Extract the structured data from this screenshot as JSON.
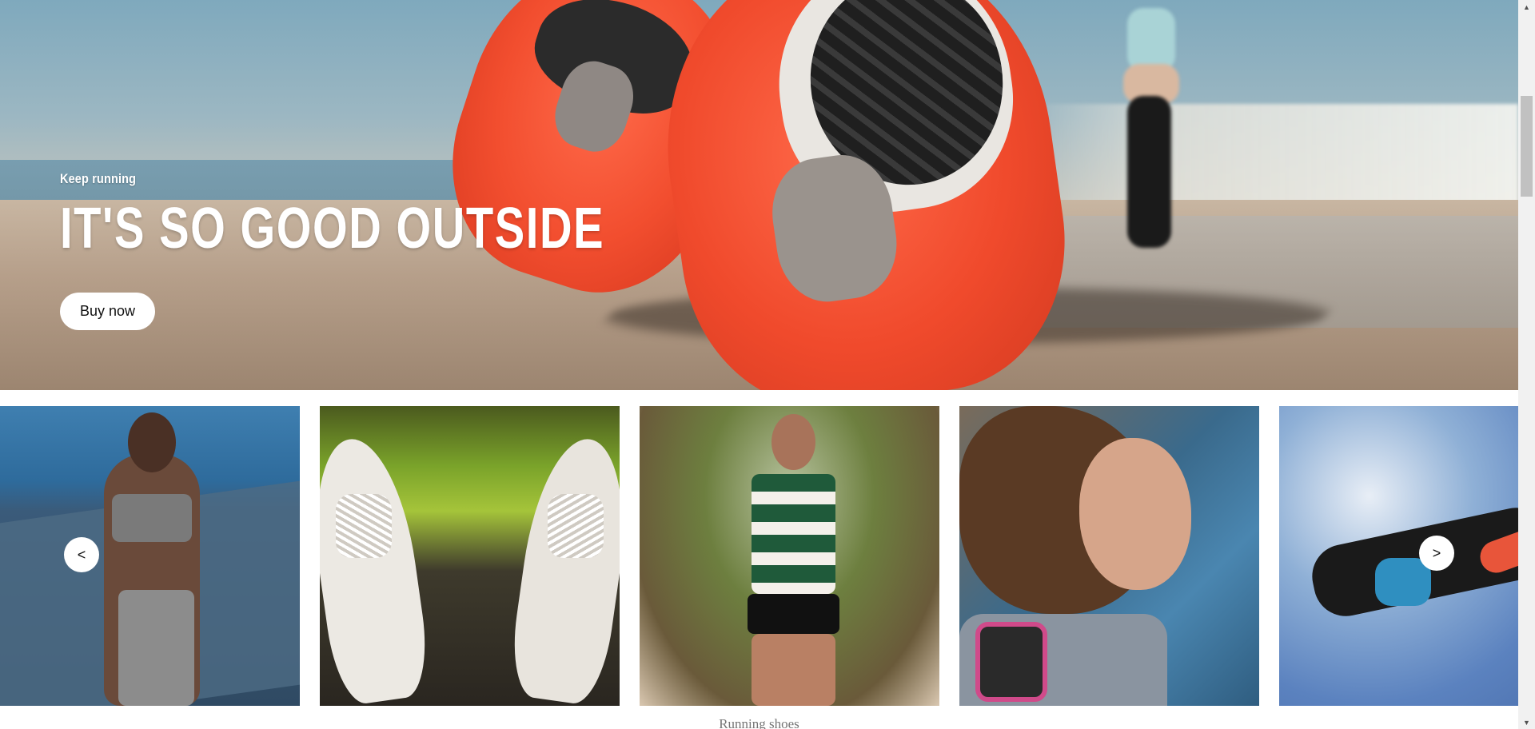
{
  "hero": {
    "subtitle": "Keep running",
    "title": "IT'S SO GOOD OUTSIDE",
    "cta_label": "Buy now"
  },
  "carousel": {
    "prev_label": "<",
    "next_label": ">",
    "caption": "Running shoes",
    "slides": [
      {
        "name": "woman-running-by-sea"
      },
      {
        "name": "sneakers-on-grass"
      },
      {
        "name": "man-racing-in-vest"
      },
      {
        "name": "woman-with-earphones"
      },
      {
        "name": "person-jumping-sky"
      }
    ]
  },
  "colors": {
    "accent_shoe": "#f24e2f",
    "button_bg": "#ffffff",
    "caption_text": "#757575"
  },
  "icons": {
    "scroll_up": "triangle-up-icon",
    "scroll_down": "triangle-down-icon"
  }
}
